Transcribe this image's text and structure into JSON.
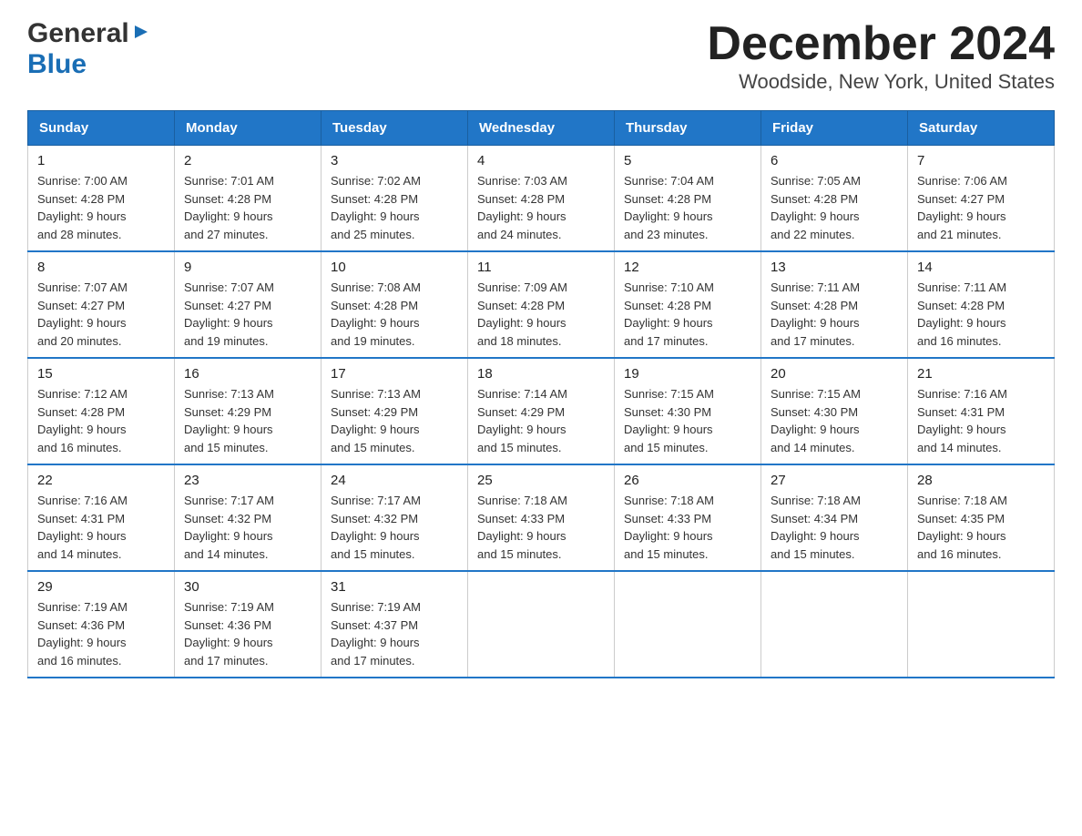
{
  "header": {
    "logo_general": "General",
    "logo_blue": "Blue",
    "title": "December 2024",
    "subtitle": "Woodside, New York, United States"
  },
  "days_of_week": [
    "Sunday",
    "Monday",
    "Tuesday",
    "Wednesday",
    "Thursday",
    "Friday",
    "Saturday"
  ],
  "weeks": [
    [
      {
        "num": "1",
        "sunrise": "7:00 AM",
        "sunset": "4:28 PM",
        "daylight": "9 hours and 28 minutes."
      },
      {
        "num": "2",
        "sunrise": "7:01 AM",
        "sunset": "4:28 PM",
        "daylight": "9 hours and 27 minutes."
      },
      {
        "num": "3",
        "sunrise": "7:02 AM",
        "sunset": "4:28 PM",
        "daylight": "9 hours and 25 minutes."
      },
      {
        "num": "4",
        "sunrise": "7:03 AM",
        "sunset": "4:28 PM",
        "daylight": "9 hours and 24 minutes."
      },
      {
        "num": "5",
        "sunrise": "7:04 AM",
        "sunset": "4:28 PM",
        "daylight": "9 hours and 23 minutes."
      },
      {
        "num": "6",
        "sunrise": "7:05 AM",
        "sunset": "4:28 PM",
        "daylight": "9 hours and 22 minutes."
      },
      {
        "num": "7",
        "sunrise": "7:06 AM",
        "sunset": "4:27 PM",
        "daylight": "9 hours and 21 minutes."
      }
    ],
    [
      {
        "num": "8",
        "sunrise": "7:07 AM",
        "sunset": "4:27 PM",
        "daylight": "9 hours and 20 minutes."
      },
      {
        "num": "9",
        "sunrise": "7:07 AM",
        "sunset": "4:27 PM",
        "daylight": "9 hours and 19 minutes."
      },
      {
        "num": "10",
        "sunrise": "7:08 AM",
        "sunset": "4:28 PM",
        "daylight": "9 hours and 19 minutes."
      },
      {
        "num": "11",
        "sunrise": "7:09 AM",
        "sunset": "4:28 PM",
        "daylight": "9 hours and 18 minutes."
      },
      {
        "num": "12",
        "sunrise": "7:10 AM",
        "sunset": "4:28 PM",
        "daylight": "9 hours and 17 minutes."
      },
      {
        "num": "13",
        "sunrise": "7:11 AM",
        "sunset": "4:28 PM",
        "daylight": "9 hours and 17 minutes."
      },
      {
        "num": "14",
        "sunrise": "7:11 AM",
        "sunset": "4:28 PM",
        "daylight": "9 hours and 16 minutes."
      }
    ],
    [
      {
        "num": "15",
        "sunrise": "7:12 AM",
        "sunset": "4:28 PM",
        "daylight": "9 hours and 16 minutes."
      },
      {
        "num": "16",
        "sunrise": "7:13 AM",
        "sunset": "4:29 PM",
        "daylight": "9 hours and 15 minutes."
      },
      {
        "num": "17",
        "sunrise": "7:13 AM",
        "sunset": "4:29 PM",
        "daylight": "9 hours and 15 minutes."
      },
      {
        "num": "18",
        "sunrise": "7:14 AM",
        "sunset": "4:29 PM",
        "daylight": "9 hours and 15 minutes."
      },
      {
        "num": "19",
        "sunrise": "7:15 AM",
        "sunset": "4:30 PM",
        "daylight": "9 hours and 15 minutes."
      },
      {
        "num": "20",
        "sunrise": "7:15 AM",
        "sunset": "4:30 PM",
        "daylight": "9 hours and 14 minutes."
      },
      {
        "num": "21",
        "sunrise": "7:16 AM",
        "sunset": "4:31 PM",
        "daylight": "9 hours and 14 minutes."
      }
    ],
    [
      {
        "num": "22",
        "sunrise": "7:16 AM",
        "sunset": "4:31 PM",
        "daylight": "9 hours and 14 minutes."
      },
      {
        "num": "23",
        "sunrise": "7:17 AM",
        "sunset": "4:32 PM",
        "daylight": "9 hours and 14 minutes."
      },
      {
        "num": "24",
        "sunrise": "7:17 AM",
        "sunset": "4:32 PM",
        "daylight": "9 hours and 15 minutes."
      },
      {
        "num": "25",
        "sunrise": "7:18 AM",
        "sunset": "4:33 PM",
        "daylight": "9 hours and 15 minutes."
      },
      {
        "num": "26",
        "sunrise": "7:18 AM",
        "sunset": "4:33 PM",
        "daylight": "9 hours and 15 minutes."
      },
      {
        "num": "27",
        "sunrise": "7:18 AM",
        "sunset": "4:34 PM",
        "daylight": "9 hours and 15 minutes."
      },
      {
        "num": "28",
        "sunrise": "7:18 AM",
        "sunset": "4:35 PM",
        "daylight": "9 hours and 16 minutes."
      }
    ],
    [
      {
        "num": "29",
        "sunrise": "7:19 AM",
        "sunset": "4:36 PM",
        "daylight": "9 hours and 16 minutes."
      },
      {
        "num": "30",
        "sunrise": "7:19 AM",
        "sunset": "4:36 PM",
        "daylight": "9 hours and 17 minutes."
      },
      {
        "num": "31",
        "sunrise": "7:19 AM",
        "sunset": "4:37 PM",
        "daylight": "9 hours and 17 minutes."
      },
      null,
      null,
      null,
      null
    ]
  ],
  "labels": {
    "sunrise": "Sunrise:",
    "sunset": "Sunset:",
    "daylight": "Daylight:"
  }
}
